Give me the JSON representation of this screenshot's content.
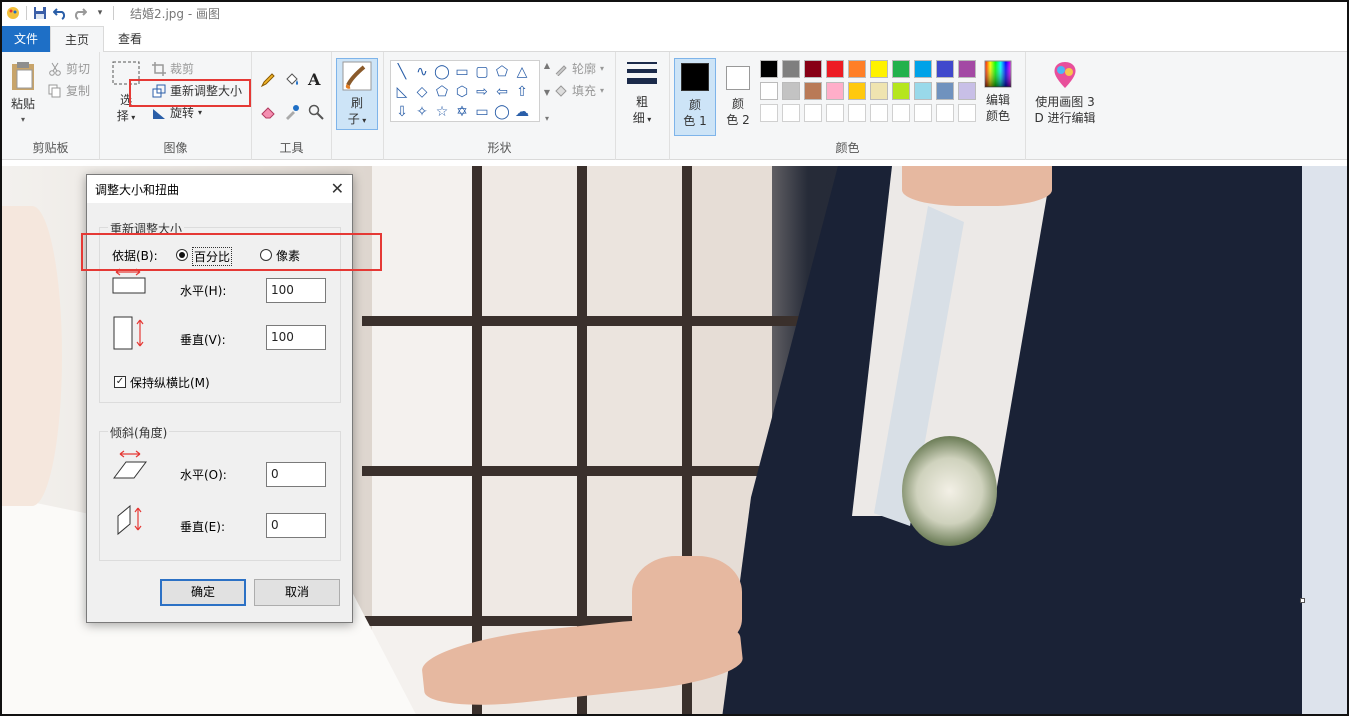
{
  "window": {
    "title": "结婚2.jpg - 画图"
  },
  "quick_access": {
    "icons": [
      "paint-app-icon",
      "save-icon",
      "undo-icon",
      "redo-icon",
      "customize-dropdown-icon"
    ]
  },
  "tabs": [
    {
      "label": "文件"
    },
    {
      "label": "主页"
    },
    {
      "label": "查看"
    }
  ],
  "ribbon": {
    "clipboard": {
      "label": "剪贴板",
      "paste": "粘贴",
      "cut": "剪切",
      "copy": "复制"
    },
    "image": {
      "label": "图像",
      "select_1": "选",
      "select_2": "择",
      "crop": "裁剪",
      "resize": "重新调整大小",
      "rotate": "旋转"
    },
    "tools": {
      "label": "工具"
    },
    "brushes": {
      "label_1": "刷",
      "label_2": "子"
    },
    "shapes": {
      "label": "形状",
      "outline": "轮廓",
      "fill": "填充"
    },
    "size": {
      "label_1": "粗",
      "label_2": "细"
    },
    "colors": {
      "label": "颜色",
      "color1_a": "颜",
      "color1_b": "色 1",
      "color2_a": "颜",
      "color2_b": "色 2",
      "edit_a": "编辑",
      "edit_b": "颜色",
      "color1_value": "#000000",
      "color2_value": "#ffffff",
      "palette_row1": [
        "#000000",
        "#7f7f7f",
        "#880015",
        "#ed1c24",
        "#ff7f27",
        "#fff200",
        "#22b14c",
        "#00a2e8",
        "#3f48cc",
        "#a349a4"
      ],
      "palette_row2": [
        "#ffffff",
        "#c3c3c3",
        "#b97a57",
        "#ffaec9",
        "#ffc90e",
        "#efe4b0",
        "#b5e61d",
        "#99d9ea",
        "#7092be",
        "#c8bfe7"
      ]
    },
    "paint3d": {
      "label_a": "使用画图 3",
      "label_b": "D 进行编辑"
    }
  },
  "dialog": {
    "title": "调整大小和扭曲",
    "resize_group": "重新调整大小",
    "by_label": "依据(B):",
    "percent": "百分比",
    "pixels": "像素",
    "horizontal_label": "水平(H):",
    "horizontal_value": "100",
    "vertical_label": "垂直(V):",
    "vertical_value": "100",
    "keep_ratio": "保持纵横比(M)",
    "skew_group": "倾斜(角度)",
    "skew_h_label": "水平(O):",
    "skew_h_value": "0",
    "skew_v_label": "垂直(E):",
    "skew_v_value": "0",
    "ok": "确定",
    "cancel": "取消"
  },
  "highlight_color": "#e53935",
  "accent_color": "#1e6fc6"
}
